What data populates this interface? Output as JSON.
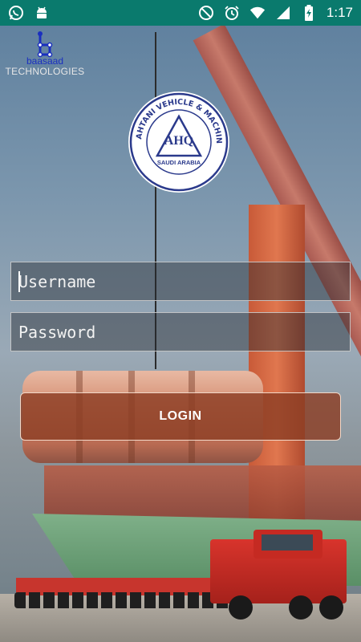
{
  "status_bar": {
    "time": "1:17",
    "left_icons": [
      "whatsapp-icon",
      "android-icon"
    ],
    "right_icons": [
      "do-not-disturb-icon",
      "alarm-icon",
      "wifi-icon",
      "signal-icon",
      "battery-charging-icon"
    ],
    "bar_color": "#0a7a6d"
  },
  "brand": {
    "name": "baasaad",
    "tagline": "TECHNOLOGIES",
    "name_color": "#1a2fbf"
  },
  "seal": {
    "top_text": "AL-QAHTANI VEHICLE & MACHINERY",
    "center_text": "AHQ",
    "country": "SAUDI ARABIA"
  },
  "form": {
    "username_placeholder": "Username",
    "password_placeholder": "Password",
    "login_label": "LOGIN"
  },
  "colors": {
    "login_button": "#8c3e24",
    "field_border": "#d2d2d2"
  }
}
